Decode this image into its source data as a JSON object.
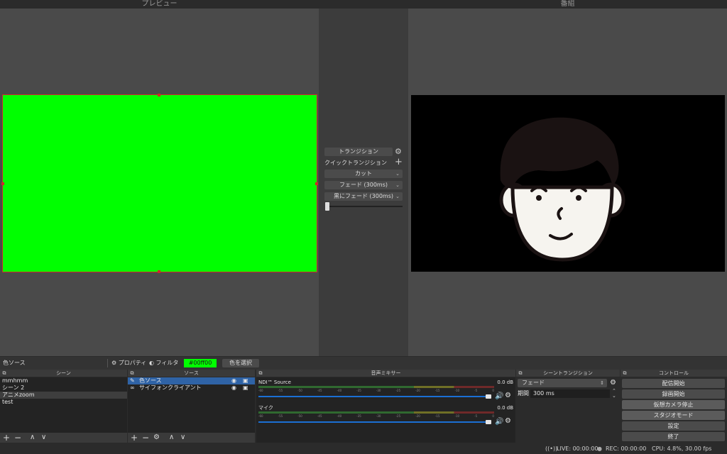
{
  "preview": {
    "title": "プレビュー",
    "source_color": "#00ff00",
    "outline_color": "#cc2a2a"
  },
  "program": {
    "title": "番組",
    "background_color": "#000000"
  },
  "transition_panel": {
    "transition_label": "トランジション",
    "quick_transition_label": "クイックトランジション",
    "options": [
      "カット",
      "フェード (300ms)",
      "黒にフェード (300ms)"
    ],
    "icons": {
      "gear": "gear-icon",
      "add": "plus-icon",
      "chevron": "chevron-down-icon"
    }
  },
  "source_bar": {
    "current_source": "色ソース",
    "properties_label": "プロパティ",
    "filters_label": "フィルタ",
    "color_value": "#00ff00",
    "pick_color_label": "色を選択"
  },
  "docks": {
    "scenes": {
      "title": "シーン",
      "items": [
        {
          "label": "mmhmm",
          "selected": false
        },
        {
          "label": "シーン 2",
          "selected": false
        },
        {
          "label": "アニメzoom",
          "selected": true
        },
        {
          "label": "test",
          "selected": false
        }
      ]
    },
    "sources": {
      "title": "ソース",
      "items": [
        {
          "label": "色ソース",
          "selected": true
        },
        {
          "label": "サイフォンクライアント",
          "selected": false
        }
      ]
    },
    "mixer": {
      "title": "音声ミキサー",
      "channels": [
        {
          "name": "NDI™ Source",
          "db": "0.0 dB"
        },
        {
          "name": "マイク",
          "db": "0.0 dB"
        }
      ],
      "ticks": [
        "-60",
        "-55",
        "-50",
        "-45",
        "-40",
        "-35",
        "-30",
        "-25",
        "-20",
        "-15",
        "-10",
        "-5",
        "0"
      ]
    },
    "scene_transitions": {
      "title": "シーントランジション",
      "selected": "フェード",
      "duration_label": "期間",
      "duration_value": "300 ms"
    },
    "controls": {
      "title": "コントロール",
      "buttons": [
        {
          "label": "配信開始",
          "active": false
        },
        {
          "label": "録画開始",
          "active": false
        },
        {
          "label": "仮想カメラ停止",
          "active": true
        },
        {
          "label": "スタジオモード",
          "active": true
        },
        {
          "label": "設定",
          "active": false
        },
        {
          "label": "終了",
          "active": false
        }
      ]
    }
  },
  "status_bar": {
    "live": "LIVE: 00:00:00",
    "rec": "REC: 00:00:00",
    "cpu": "CPU: 4.8%, 30.00 fps"
  },
  "colors": {
    "accent": "#2f63a6",
    "slider": "#1b6fd4",
    "meter_green": "#3fbf3f",
    "meter_yellow": "#cccc2a",
    "meter_red": "#cc3030"
  }
}
